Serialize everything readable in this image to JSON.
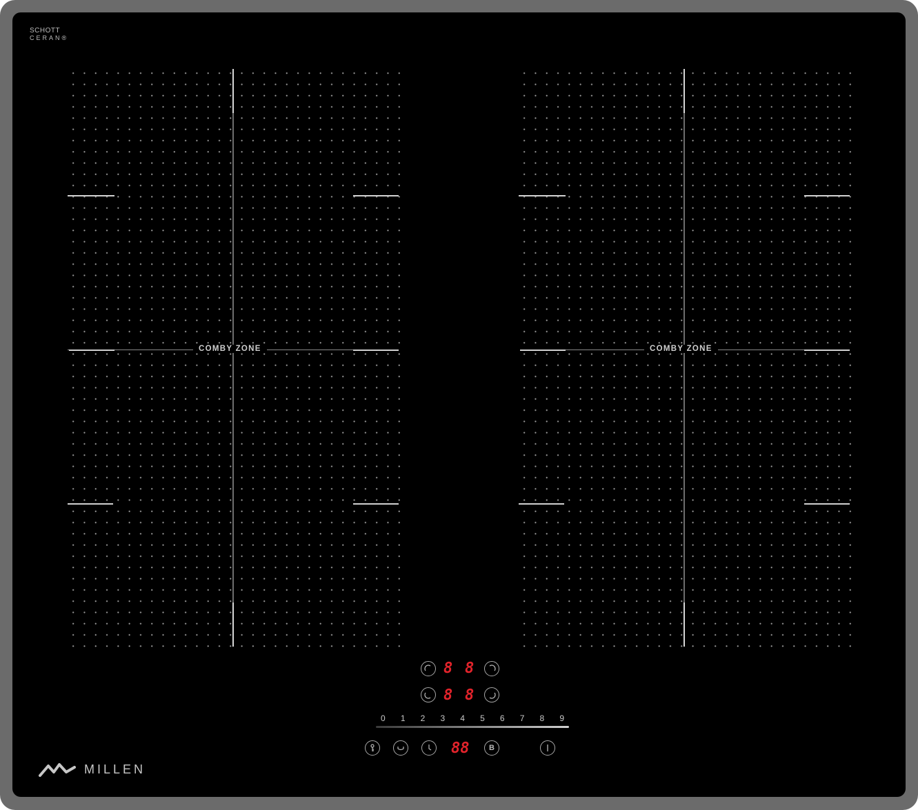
{
  "brand": {
    "material_line1": "SCHOTT",
    "material_line2": "CERAN®",
    "name": "MILLEN"
  },
  "zones": [
    {
      "label": "COMBY ZONE"
    },
    {
      "label": "COMBY ZONE"
    }
  ],
  "displays": {
    "zone_front_left": "8",
    "zone_front_right": "8",
    "zone_rear_left": "8",
    "zone_rear_right": "8",
    "timer": "88"
  },
  "power_scale": {
    "levels": [
      "0",
      "1",
      "2",
      "3",
      "4",
      "5",
      "6",
      "7",
      "8",
      "9"
    ]
  },
  "buttons": {
    "boost": "B"
  },
  "icons": [
    "lock-icon",
    "pause-icon",
    "timer-icon",
    "power-icon",
    "zone-select-icon"
  ],
  "colors": {
    "glass": "#000000",
    "frame": "#6b6b6b",
    "display_led": "#e2232b",
    "print": "#c7c7c7"
  }
}
